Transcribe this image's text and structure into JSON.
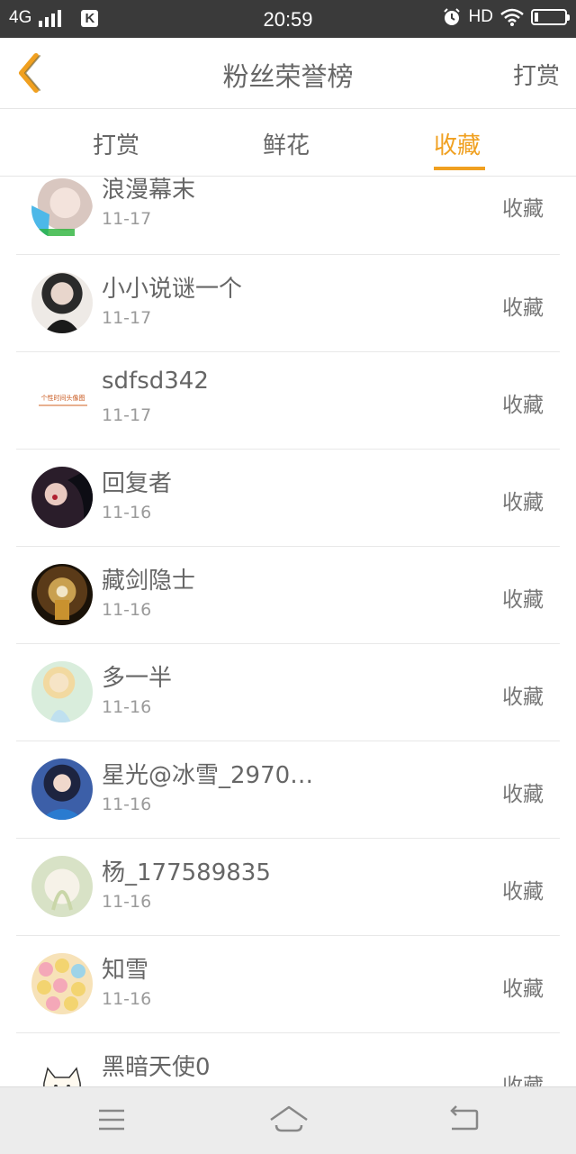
{
  "status_bar": {
    "network": "4G",
    "app_badge": "K",
    "time": "20:59",
    "hd": "HD",
    "icons": [
      "signal-icon",
      "k-app-icon",
      "alarm-icon",
      "wifi-icon",
      "battery-icon"
    ]
  },
  "header": {
    "title": "粉丝荣誉榜",
    "action_label": "打赏",
    "back_icon": "chevron-left-icon",
    "accent_color": "#f0a020"
  },
  "tabs": [
    {
      "label": "打赏",
      "active": false
    },
    {
      "label": "鲜花",
      "active": false
    },
    {
      "label": "收藏",
      "active": true
    }
  ],
  "list": [
    {
      "name": "浪漫幕末",
      "date": "11-17",
      "type": "收藏"
    },
    {
      "name": "小小说谜一个",
      "date": "11-17",
      "type": "收藏"
    },
    {
      "name": "sdfsd342",
      "date": "11-17",
      "type": "收藏",
      "avatar_text": "个性时间头像图"
    },
    {
      "name": "回复者",
      "date": "11-16",
      "type": "收藏"
    },
    {
      "name": "藏剑隐士",
      "date": "11-16",
      "type": "收藏"
    },
    {
      "name": "多一半",
      "date": "11-16",
      "type": "收藏"
    },
    {
      "name": "星光@冰雪_2970…",
      "date": "11-16",
      "type": "收藏"
    },
    {
      "name": "杨_177589835",
      "date": "11-16",
      "type": "收藏"
    },
    {
      "name": "知雪",
      "date": "11-16",
      "type": "收藏"
    },
    {
      "name": "黑暗天使0",
      "date": "",
      "type": "收藏"
    }
  ],
  "nav": {
    "icons": [
      "menu-icon",
      "home-icon",
      "back-icon"
    ]
  }
}
